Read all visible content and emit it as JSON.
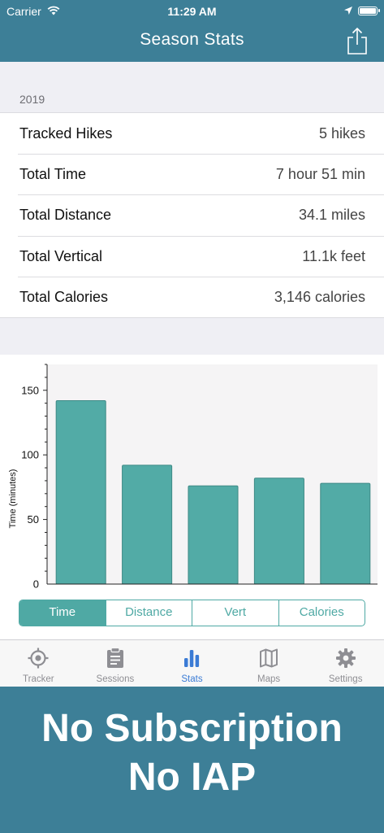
{
  "status_bar": {
    "carrier": "Carrier",
    "time": "11:29 AM"
  },
  "nav": {
    "title": "Season Stats",
    "share_icon": "share-icon"
  },
  "section": {
    "header": "2019"
  },
  "stats": [
    {
      "label": "Tracked Hikes",
      "value": "5 hikes"
    },
    {
      "label": "Total Time",
      "value": "7 hour 51 min"
    },
    {
      "label": "Total Distance",
      "value": "34.1 miles"
    },
    {
      "label": "Total Vertical",
      "value": "11.1k feet"
    },
    {
      "label": "Total Calories",
      "value": "3,146 calories"
    }
  ],
  "chart_data": {
    "type": "bar",
    "values": [
      142,
      92,
      76,
      82,
      78
    ],
    "ylabel": "Time (minutes)",
    "ylim": [
      0,
      170
    ],
    "yticks": [
      0,
      50,
      100,
      150
    ],
    "bar_color": "#52aba6",
    "grid": false
  },
  "segments": [
    {
      "label": "Time",
      "active": true
    },
    {
      "label": "Distance",
      "active": false
    },
    {
      "label": "Vert",
      "active": false
    },
    {
      "label": "Calories",
      "active": false
    }
  ],
  "tabs": [
    {
      "label": "Tracker",
      "icon": "tracker-icon",
      "active": false
    },
    {
      "label": "Sessions",
      "icon": "clipboard-icon",
      "active": false
    },
    {
      "label": "Stats",
      "icon": "bar-chart-icon",
      "active": true
    },
    {
      "label": "Maps",
      "icon": "map-icon",
      "active": false
    },
    {
      "label": "Settings",
      "icon": "gear-icon",
      "active": false
    }
  ],
  "promo": {
    "line1": "No Subscription",
    "line2": "No IAP"
  },
  "colors": {
    "brand": "#3d7f97",
    "accent": "#4fa9a4",
    "tab_active": "#3a7bd5",
    "tab_inactive": "#8e8e93"
  }
}
